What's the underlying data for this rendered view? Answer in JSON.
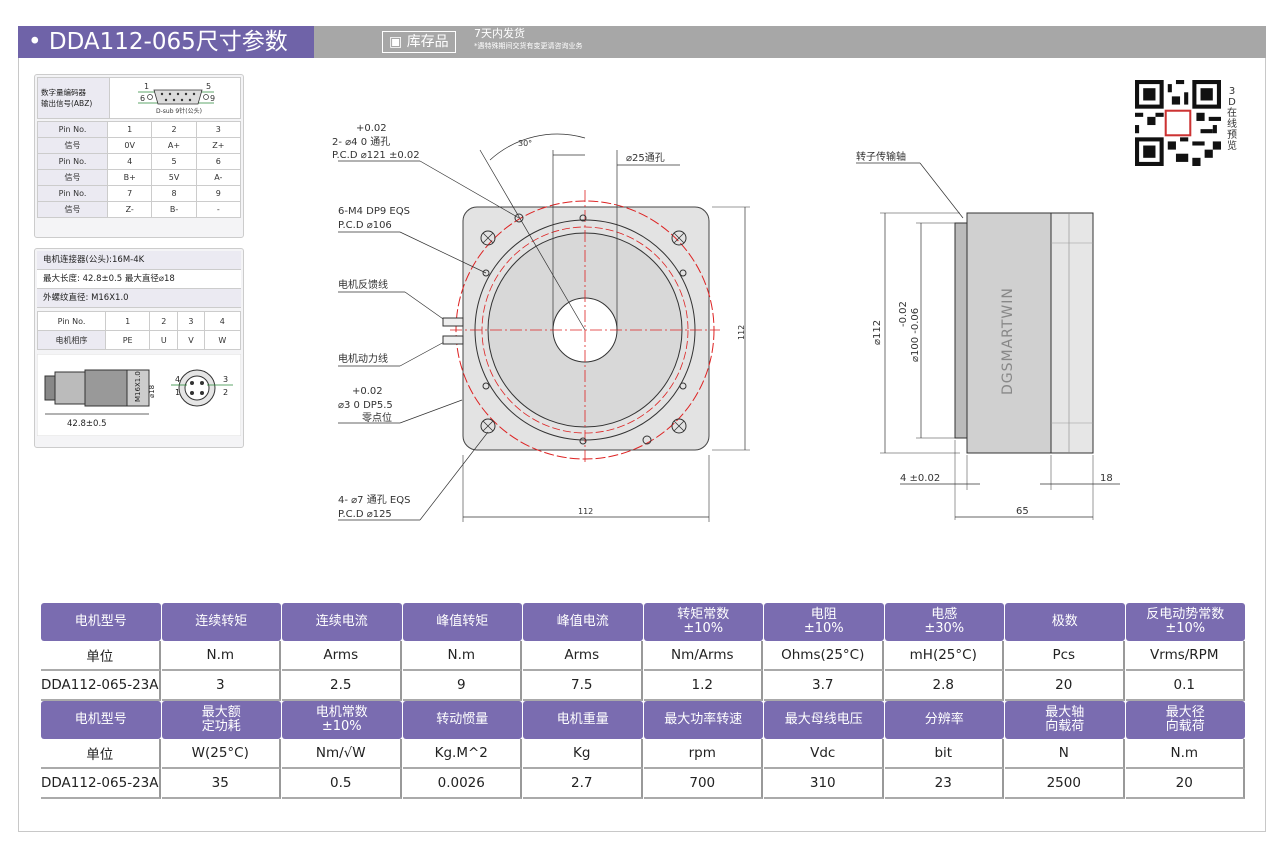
{
  "header": {
    "title": "• DDA112-065尺寸参数",
    "stock_badge": "库存品",
    "delivery": "7天内发货",
    "delivery_note": "*遇特殊期间交货有变更请咨询业务"
  },
  "encoder": {
    "label_line1": "数字量编码器",
    "label_line2": "输出信号(ABZ)",
    "dsub_top": "1       5",
    "dsub_bottom": "6       9",
    "dsub_caption": "D-sub 9针(公头)",
    "rows": [
      [
        "Pin No.",
        "1",
        "2",
        "3"
      ],
      [
        "信号",
        "0V",
        "A+",
        "Z+"
      ],
      [
        "Pin No.",
        "4",
        "5",
        "6"
      ],
      [
        "信号",
        "B+",
        "5V",
        "A-"
      ],
      [
        "Pin No.",
        "7",
        "8",
        "9"
      ],
      [
        "信号",
        "Z-",
        "B-",
        "-"
      ]
    ]
  },
  "motor_connector": {
    "line1": "电机连接器(公头):16M-4K",
    "line2": "最大长度: 42.8±0.5  最大直径⌀18",
    "line3": "外螺纹直径:  M16X1.0",
    "rows": [
      [
        "Pin No.",
        "1",
        "2",
        "3",
        "4"
      ],
      [
        "电机相序",
        "PE",
        "U",
        "V",
        "W"
      ]
    ],
    "dim_length": "42.8±0.5",
    "dim_thread": "M16X1.0",
    "dim_dia": "⌀18",
    "pins_left": [
      "4",
      "1"
    ],
    "pins_right": [
      "3",
      "2"
    ]
  },
  "front_view": {
    "hole1_tol": "+0.02",
    "hole1_a": "2- ⌀4  0     通孔",
    "hole1_b": "P.C.D  ⌀121 ±0.02",
    "angle": "30°",
    "shaft_hole": "⌀25通孔",
    "tap_a": "6-M4 DP9 EQS",
    "tap_b": "P.C.D ⌀106",
    "feedback": "电机反馈线",
    "power": "电机动力线",
    "zero_tol": "+0.02",
    "zero_a": "⌀3   0     DP5.5",
    "zero_b": "零点位",
    "mount_a": "4- ⌀7 通孔 EQS",
    "mount_b": "P.C.D ⌀125",
    "width": "112",
    "height": "112"
  },
  "side_view": {
    "rotor": "转子传输轴",
    "dia112": "⌀112",
    "dia100": "⌀100 -0.06",
    "dia100_tol": "-0.02",
    "brand": "DGSMARTWIN",
    "step": "4 ±0.02",
    "length": "65",
    "rear": "18"
  },
  "qr": {
    "side_text": [
      "3",
      "D",
      "在",
      "线",
      "预",
      "览"
    ]
  },
  "spec_table": {
    "block1": {
      "headers": [
        "电机型号",
        "连续转矩",
        "连续电流",
        "峰值转矩",
        "峰值电流",
        "转矩常数\n±10%",
        "电阻\n±10%",
        "电感\n±30%",
        "极数",
        "反电动势常数\n±10%"
      ],
      "units": [
        "单位",
        "N.m",
        "Arms",
        "N.m",
        "Arms",
        "Nm/Arms",
        "Ohms(25°C)",
        "mH(25°C)",
        "Pcs",
        "Vrms/RPM"
      ],
      "values": [
        "DDA112-065-23A",
        "3",
        "2.5",
        "9",
        "7.5",
        "1.2",
        "3.7",
        "2.8",
        "20",
        "0.1"
      ]
    },
    "block2": {
      "headers": [
        "电机型号",
        "最大额\n定功耗",
        "电机常数\n±10%",
        "转动惯量",
        "电机重量",
        "最大功率转速",
        "最大母线电压",
        "分辨率",
        "最大轴\n向载荷",
        "最大径\n向载荷"
      ],
      "units": [
        "单位",
        "W(25°C)",
        "Nm/√W",
        "Kg.M^2",
        "Kg",
        "rpm",
        "Vdc",
        "bit",
        "N",
        "N.m"
      ],
      "values": [
        "DDA112-065-23A",
        "35",
        "0.5",
        "0.0026",
        "2.7",
        "700",
        "310",
        "23",
        "2500",
        "20"
      ]
    }
  }
}
